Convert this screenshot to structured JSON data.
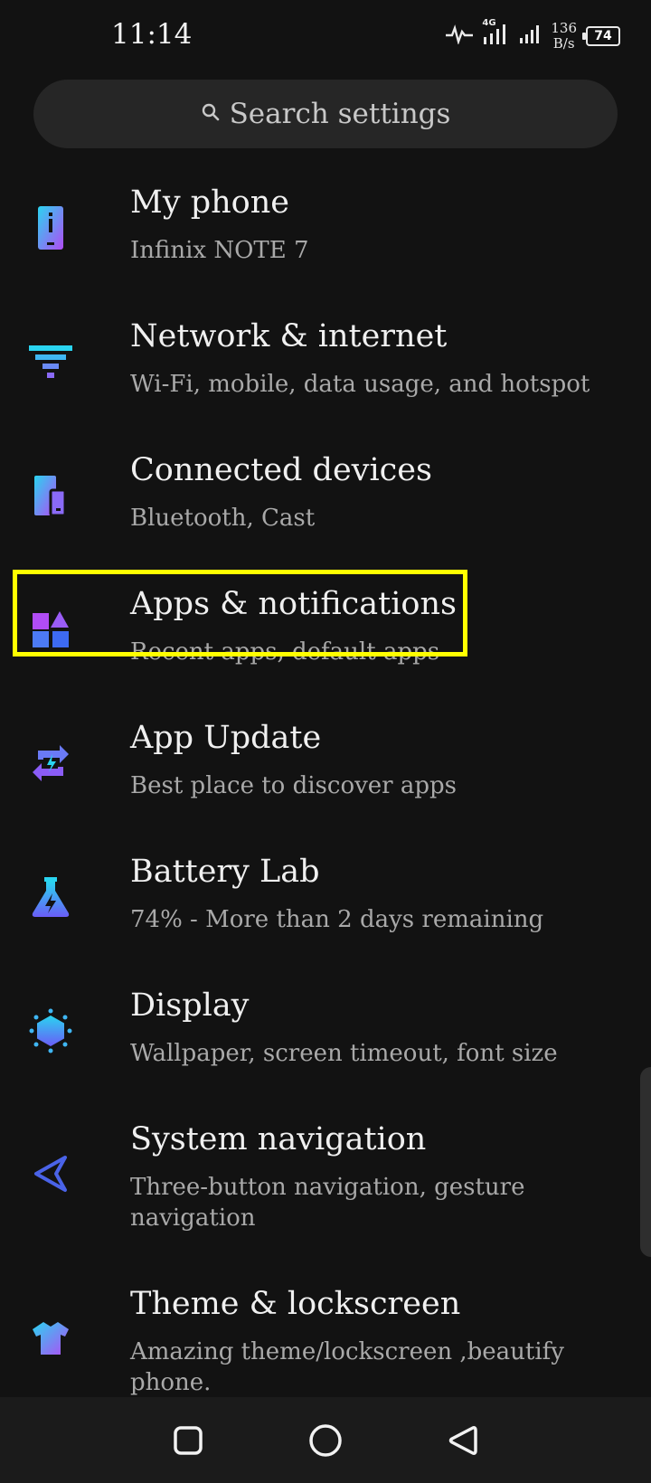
{
  "status_bar": {
    "time": "11:14",
    "network_type": "4G",
    "speed_value": "136",
    "speed_unit": "B/s",
    "battery_level": "74"
  },
  "search": {
    "placeholder": "Search settings"
  },
  "settings_items": [
    {
      "title": "My phone",
      "subtitle": "Infinix NOTE 7",
      "icon": "phone-info-icon"
    },
    {
      "title": "Network & internet",
      "subtitle": "Wi-Fi, mobile, data usage, and hotspot",
      "icon": "network-icon"
    },
    {
      "title": "Connected devices",
      "subtitle": "Bluetooth, Cast",
      "icon": "connected-devices-icon"
    },
    {
      "title": "Apps & notifications",
      "subtitle": "Recent apps, default apps",
      "icon": "apps-icon"
    },
    {
      "title": "App Update",
      "subtitle": "Best place to discover apps",
      "icon": "app-update-icon"
    },
    {
      "title": "Battery Lab",
      "subtitle": "74% - More than 2 days remaining",
      "icon": "battery-lab-icon"
    },
    {
      "title": "Display",
      "subtitle": "Wallpaper, screen timeout, font size",
      "icon": "display-icon"
    },
    {
      "title": "System navigation",
      "subtitle": "Three-button navigation, gesture navigation",
      "icon": "navigation-icon"
    },
    {
      "title": "Theme & lockscreen",
      "subtitle": "Amazing theme/lockscreen ,beautify phone.",
      "icon": "theme-icon"
    }
  ],
  "colors": {
    "background": "#121212",
    "highlight": "#ffff00",
    "icon_gradient_start": "#2ad4f0",
    "icon_gradient_end": "#b14cf5"
  },
  "nav_bar": {
    "icons": [
      "recents-icon",
      "home-icon",
      "back-icon"
    ]
  }
}
